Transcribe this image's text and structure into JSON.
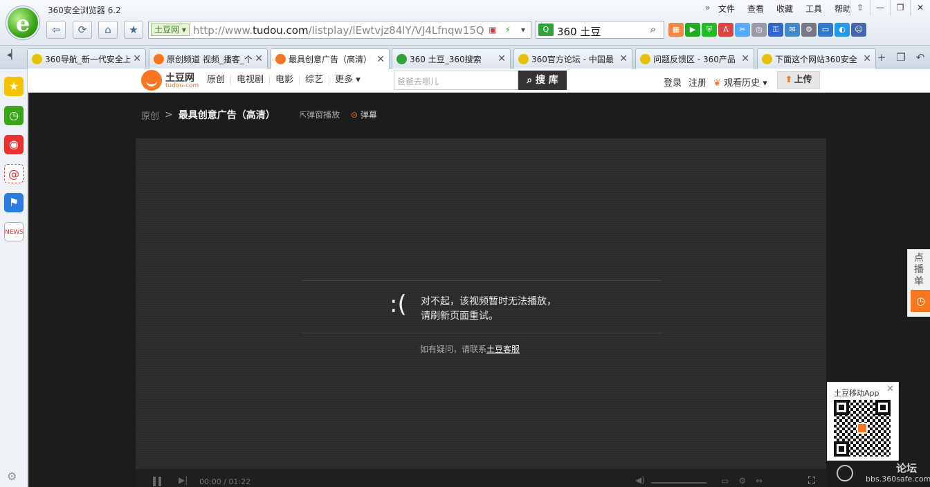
{
  "browser": {
    "title": "360安全浏览器 6.2",
    "menu_more": "»",
    "menu": [
      "文件",
      "查看",
      "收藏",
      "工具",
      "帮助"
    ],
    "window_controls": [
      "⇧",
      "—",
      "❐",
      "✕"
    ],
    "address": {
      "site_chip": "土豆网",
      "url_prefix": "http://www.",
      "url_domain": "tudou.com",
      "url_path": "/listplay/lEwtvjz84lY/VJ4Lfnqw15Q."
    },
    "search": {
      "value": "360 土豆"
    },
    "tabs": [
      {
        "label": "360导航_新一代安全上",
        "icon_color": "#e8c200"
      },
      {
        "label": "原创频道 视频_播客_个",
        "icon_color": "#f7761f"
      },
      {
        "label": "最具创意广告（高清）",
        "icon_color": "#f7761f"
      },
      {
        "label": "360 土豆_360搜索",
        "icon_color": "#2fa33a"
      },
      {
        "label": "360官方论坛 - 中国最",
        "icon_color": "#e8c200"
      },
      {
        "label": "问题反馈区 - 360产品",
        "icon_color": "#e8c200"
      },
      {
        "label": "下面这个网站360安全",
        "icon_color": "#e8c200"
      }
    ],
    "active_tab": 2
  },
  "site": {
    "logo_name": "土豆网",
    "logo_domain": "tudou.com",
    "nav": [
      "原创",
      "电视剧",
      "电影",
      "综艺",
      "更多"
    ],
    "search_placeholder": "爸爸去哪儿",
    "search_button": "搜 库",
    "login": "登录",
    "register": "注册",
    "history": "观看历史",
    "upload": "上传"
  },
  "breadcrumb": {
    "root": "原创",
    "separator": ">",
    "title": "最具创意广告（高清）",
    "popout": "弹窗播放",
    "danmu": "弹幕"
  },
  "player": {
    "error_face": ":(",
    "error_line1": "对不起，该视频暂时无法播放，",
    "error_line2": "请刷新页面重试。",
    "contact_prefix": "如有疑问，请联系",
    "contact_link": "土豆客服",
    "time": "00:00 / 01:22"
  },
  "playlist_tab": {
    "label": "点播单"
  },
  "qr_popup": {
    "title": "土豆移动App"
  },
  "watermark": {
    "title": "论坛",
    "url": "bbs.360safe.com"
  },
  "colors": {
    "brand": "#f7761f",
    "page_bg": "#1c1c1c"
  }
}
